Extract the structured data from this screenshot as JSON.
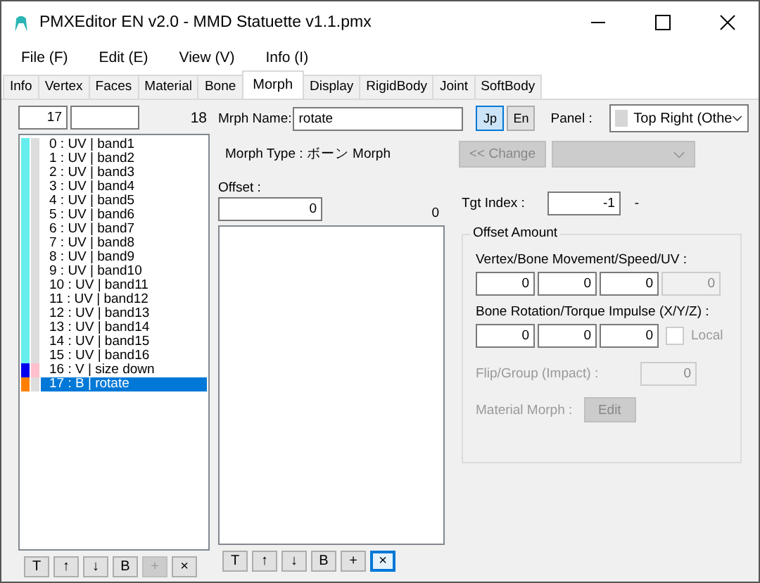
{
  "window": {
    "title": "PMXEditor EN v2.0 - MMD Statuette v1.1.pmx"
  },
  "menu": [
    "File (F)",
    "Edit (E)",
    "View (V)",
    "Info (I)"
  ],
  "tabs": [
    {
      "label": "Info",
      "selected": false
    },
    {
      "label": "Vertex",
      "selected": false
    },
    {
      "label": "Faces",
      "selected": false
    },
    {
      "label": "Material",
      "selected": false
    },
    {
      "label": "Bone",
      "selected": false
    },
    {
      "label": "Morph",
      "selected": true
    },
    {
      "label": "Display",
      "selected": false
    },
    {
      "label": "RigidBody",
      "selected": false
    },
    {
      "label": "Joint",
      "selected": false
    },
    {
      "label": "SoftBody",
      "selected": false
    }
  ],
  "morph_list": {
    "index": "17",
    "count": "18",
    "items": [
      {
        "label": "0 : UV | band1",
        "swatches": [
          {
            "color": "#66eeee"
          },
          {
            "color": "#dddddd"
          }
        ],
        "selected": false
      },
      {
        "label": "1 : UV | band2",
        "swatches": [
          {
            "color": "#66eeee"
          },
          {
            "color": "#dddddd"
          }
        ],
        "selected": false
      },
      {
        "label": "2 : UV | band3",
        "swatches": [
          {
            "color": "#66eeee"
          },
          {
            "color": "#dddddd"
          }
        ],
        "selected": false
      },
      {
        "label": "3 : UV | band4",
        "swatches": [
          {
            "color": "#66eeee"
          },
          {
            "color": "#dddddd"
          }
        ],
        "selected": false
      },
      {
        "label": "4 : UV | band5",
        "swatches": [
          {
            "color": "#66eeee"
          },
          {
            "color": "#dddddd"
          }
        ],
        "selected": false
      },
      {
        "label": "5 : UV | band6",
        "swatches": [
          {
            "color": "#66eeee"
          },
          {
            "color": "#dddddd"
          }
        ],
        "selected": false
      },
      {
        "label": "6 : UV | band7",
        "swatches": [
          {
            "color": "#66eeee"
          },
          {
            "color": "#dddddd"
          }
        ],
        "selected": false
      },
      {
        "label": "7 : UV | band8",
        "swatches": [
          {
            "color": "#66eeee"
          },
          {
            "color": "#dddddd"
          }
        ],
        "selected": false
      },
      {
        "label": "8 : UV | band9",
        "swatches": [
          {
            "color": "#66eeee"
          },
          {
            "color": "#dddddd"
          }
        ],
        "selected": false
      },
      {
        "label": "9 : UV | band10",
        "swatches": [
          {
            "color": "#66eeee"
          },
          {
            "color": "#dddddd"
          }
        ],
        "selected": false
      },
      {
        "label": "10 : UV | band11",
        "swatches": [
          {
            "color": "#66eeee"
          },
          {
            "color": "#dddddd"
          }
        ],
        "selected": false
      },
      {
        "label": "11 : UV | band12",
        "swatches": [
          {
            "color": "#66eeee"
          },
          {
            "color": "#dddddd"
          }
        ],
        "selected": false
      },
      {
        "label": "12 : UV | band13",
        "swatches": [
          {
            "color": "#66eeee"
          },
          {
            "color": "#dddddd"
          }
        ],
        "selected": false
      },
      {
        "label": "13 : UV | band14",
        "swatches": [
          {
            "color": "#66eeee"
          },
          {
            "color": "#dddddd"
          }
        ],
        "selected": false
      },
      {
        "label": "14 : UV | band15",
        "swatches": [
          {
            "color": "#66eeee"
          },
          {
            "color": "#dddddd"
          }
        ],
        "selected": false
      },
      {
        "label": "15 : UV | band16",
        "swatches": [
          {
            "color": "#66eeee"
          },
          {
            "color": "#dddddd"
          }
        ],
        "selected": false
      },
      {
        "label": "16 : V | size down",
        "swatches": [
          {
            "color": "#0000ee"
          },
          {
            "color": "#ffc0cc"
          }
        ],
        "selected": false
      },
      {
        "label": "17 : B | rotate",
        "swatches": [
          {
            "color": "#ff8000"
          },
          {
            "color": "#dddddd"
          }
        ],
        "selected": true
      }
    ],
    "buttons": [
      {
        "label": "T",
        "disabled": false,
        "focused": false
      },
      {
        "label": "↑",
        "disabled": false,
        "focused": false
      },
      {
        "label": "↓",
        "disabled": false,
        "focused": false
      },
      {
        "label": "B",
        "disabled": false,
        "focused": false
      },
      {
        "label": "+",
        "disabled": true,
        "focused": false
      },
      {
        "label": "×",
        "disabled": false,
        "focused": false
      }
    ]
  },
  "morph_name": {
    "label": "Mrph Name:",
    "value": "rotate"
  },
  "lang_buttons": [
    {
      "label": "Jp",
      "selected": true
    },
    {
      "label": "En",
      "selected": false
    }
  ],
  "panel": {
    "label": "Panel :",
    "value": "Top Right (Othe"
  },
  "morph_type": "Morph Type : ボーン Morph",
  "change_button": {
    "label": "<< Change",
    "disabled": true
  },
  "offset": {
    "label": "Offset :",
    "value": "0",
    "count": "0",
    "buttons": [
      {
        "label": "T",
        "disabled": false,
        "focused": false
      },
      {
        "label": "↑",
        "disabled": false,
        "focused": false
      },
      {
        "label": "↓",
        "disabled": false,
        "focused": false
      },
      {
        "label": "B",
        "disabled": false,
        "focused": false
      },
      {
        "label": "+",
        "disabled": false,
        "focused": false
      },
      {
        "label": "×",
        "disabled": false,
        "focused": true
      }
    ]
  },
  "target": {
    "label": "Tgt Index :",
    "value": "-1",
    "name": "-"
  },
  "offset_amount": {
    "title": "Offset Amount",
    "movement": {
      "label": "Vertex/Bone Movement/Speed/UV :",
      "values": [
        {
          "value": "0",
          "disabled": false
        },
        {
          "value": "0",
          "disabled": false
        },
        {
          "value": "0",
          "disabled": false
        },
        {
          "value": "0",
          "disabled": true
        }
      ]
    },
    "rotation": {
      "label": "Bone Rotation/Torque Impulse (X/Y/Z) :",
      "values": [
        "0",
        "0",
        "0"
      ]
    },
    "local": {
      "label": "Local",
      "checked": false,
      "disabled": true
    },
    "flip": {
      "label": "Flip/Group (Impact) :",
      "value": "0",
      "disabled": true
    },
    "material": {
      "label": "Material Morph :",
      "button": "Edit",
      "disabled": true
    }
  }
}
